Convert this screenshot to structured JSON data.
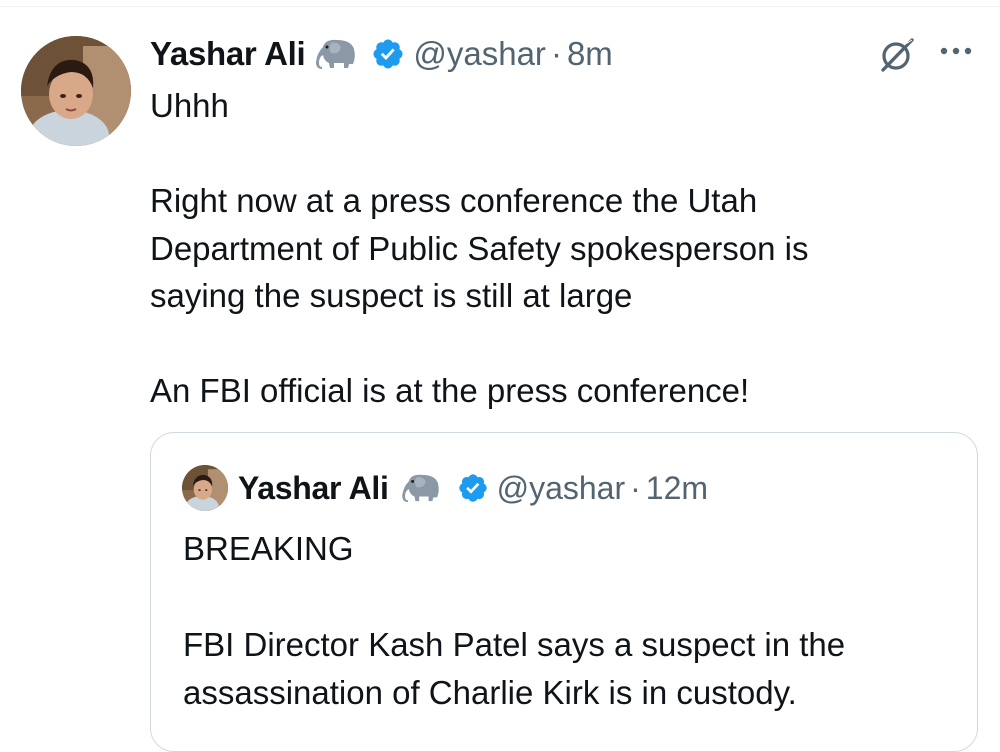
{
  "tweet": {
    "display_name": "Yashar Ali",
    "name_emoji": "🐘",
    "handle": "@yashar",
    "separator": "·",
    "time": "8m",
    "text": "Uhhh\n\nRight now at a press conference the Utah\nDepartment of Public Safety spokesperson is\nsaying the suspect is still at large\n\nAn FBI official is at the press conference!",
    "icons": [
      "avatar",
      "elephant-emoji",
      "verified-badge-icon",
      "grok-icon",
      "more-options-icon"
    ]
  },
  "quote": {
    "display_name": "Yashar Ali",
    "name_emoji": "🐘",
    "handle": "@yashar",
    "separator": "·",
    "time": "12m",
    "text": "BREAKING\n\nFBI Director Kash Patel says a suspect in the\nassassination of Charlie Kirk is in custody."
  },
  "colors": {
    "text_primary": "#0f1419",
    "text_secondary": "#536471",
    "verified_blue": "#1d9bf0",
    "border": "#cfd9de"
  }
}
